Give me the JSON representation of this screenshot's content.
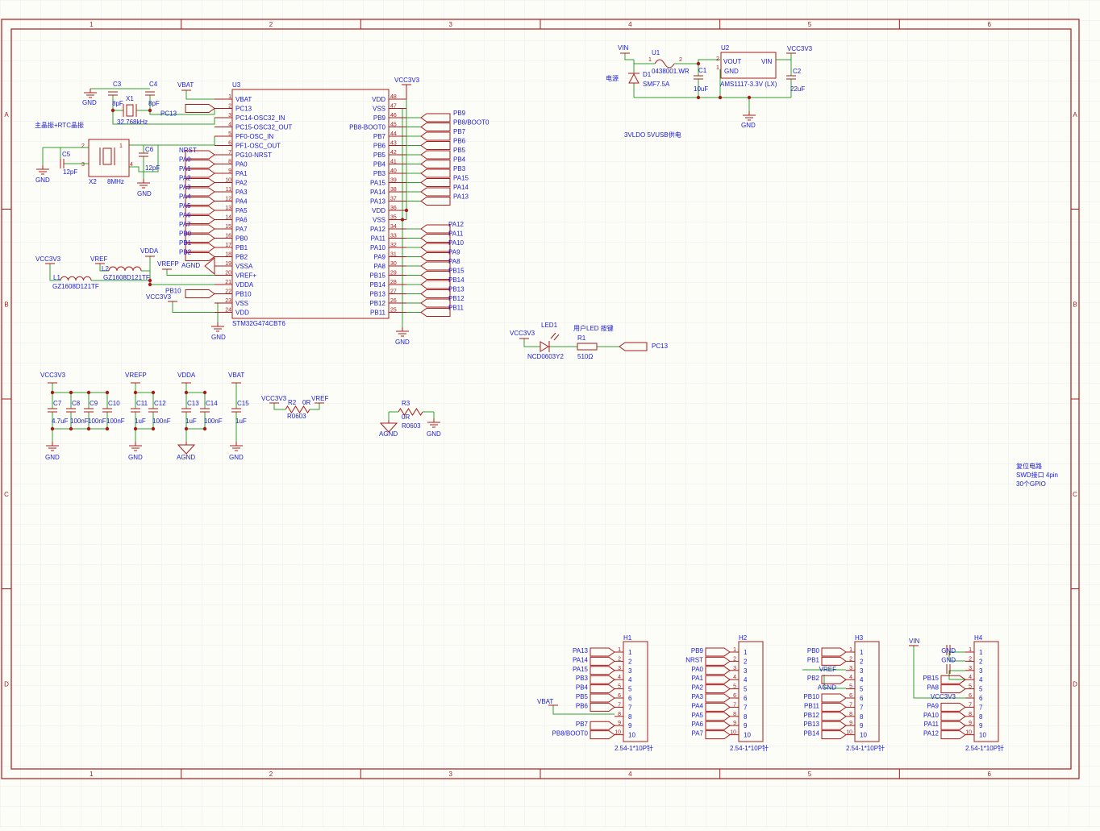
{
  "colors": {
    "frame": "#a61c1c",
    "part": "#a61c1c",
    "wire": "#2e9e2e",
    "text": "#1a1ad6",
    "grid": "#ececec",
    "paper": "#fdfdf8"
  },
  "frame": {
    "cols": [
      "1",
      "2",
      "3",
      "4",
      "5",
      "6"
    ],
    "rows": [
      "A",
      "B",
      "C",
      "D"
    ]
  },
  "mcu": {
    "ref": "U3",
    "part": "STM32G474CBT6",
    "left_pins": [
      {
        "num": "1",
        "name": "VBAT"
      },
      {
        "num": "2",
        "name": "PC13"
      },
      {
        "num": "3",
        "name": "PC14-OSC32_IN"
      },
      {
        "num": "4",
        "name": "PC15-OSC32_OUT"
      },
      {
        "num": "5",
        "name": "PF0-OSC_IN"
      },
      {
        "num": "6",
        "name": "PF1-OSC_OUT"
      },
      {
        "num": "7",
        "name": "PG10-NRST"
      },
      {
        "num": "8",
        "name": "PA0"
      },
      {
        "num": "9",
        "name": "PA1"
      },
      {
        "num": "10",
        "name": "PA2"
      },
      {
        "num": "11",
        "name": "PA3"
      },
      {
        "num": "12",
        "name": "PA4"
      },
      {
        "num": "13",
        "name": "PA5"
      },
      {
        "num": "14",
        "name": "PA6"
      },
      {
        "num": "15",
        "name": "PA7"
      },
      {
        "num": "16",
        "name": "PB0"
      },
      {
        "num": "17",
        "name": "PB1"
      },
      {
        "num": "18",
        "name": "PB2"
      },
      {
        "num": "19",
        "name": "VSSA"
      },
      {
        "num": "20",
        "name": "VREF+"
      },
      {
        "num": "21",
        "name": "VDDA"
      },
      {
        "num": "22",
        "name": "PB10"
      },
      {
        "num": "23",
        "name": "VSS"
      },
      {
        "num": "24",
        "name": "VDD"
      }
    ],
    "right_pins": [
      {
        "num": "48",
        "name": "VDD"
      },
      {
        "num": "47",
        "name": "VSS"
      },
      {
        "num": "46",
        "name": "PB9"
      },
      {
        "num": "45",
        "name": "PB8-BOOT0"
      },
      {
        "num": "44",
        "name": "PB7"
      },
      {
        "num": "43",
        "name": "PB6"
      },
      {
        "num": "42",
        "name": "PB5"
      },
      {
        "num": "41",
        "name": "PB4"
      },
      {
        "num": "40",
        "name": "PB3"
      },
      {
        "num": "39",
        "name": "PA15"
      },
      {
        "num": "38",
        "name": "PA14"
      },
      {
        "num": "37",
        "name": "PA13"
      },
      {
        "num": "36",
        "name": "VDD"
      },
      {
        "num": "35",
        "name": "VSS"
      },
      {
        "num": "34",
        "name": "PA12"
      },
      {
        "num": "33",
        "name": "PA11"
      },
      {
        "num": "32",
        "name": "PA10"
      },
      {
        "num": "31",
        "name": "PA9"
      },
      {
        "num": "30",
        "name": "PA8"
      },
      {
        "num": "29",
        "name": "PB15"
      },
      {
        "num": "28",
        "name": "PB14"
      },
      {
        "num": "27",
        "name": "PB13"
      },
      {
        "num": "26",
        "name": "PB12"
      },
      {
        "num": "25",
        "name": "PB11"
      }
    ],
    "left_ports": [
      "NRST",
      "PA0",
      "PA1",
      "PA2",
      "PA3",
      "PA4",
      "PA5",
      "PA6",
      "PA7",
      "PB0",
      "PB1",
      "PB2"
    ],
    "pc13_port": "PC13",
    "pb10_port": "PB10",
    "top_ports": [
      "PB9",
      "PB8/BOOT0",
      "PB7",
      "PB6",
      "PB5",
      "PB4",
      "PB3",
      "PA15",
      "PA14",
      "PA13"
    ],
    "bottom_ports": [
      "PA12",
      "PA11",
      "PA10",
      "PA9",
      "PA8",
      "PB15",
      "PB14",
      "PB13",
      "PB12",
      "PB11"
    ],
    "vcc_label": "VCC3V3",
    "vbat_label": "VBAT",
    "gnd_label": "GND",
    "vdda_label": "VDDA",
    "vrefp_label": "VREFP",
    "agnd_label": "AGND",
    "vcc_bottom_label": "VCC3V3"
  },
  "clock": {
    "title": "主晶振+RTC晶振",
    "c3": "C3",
    "c3_val": "8pF",
    "c4": "C4",
    "c4_val": "8pF",
    "x1": "X1",
    "x1_val": "32.768kHz",
    "c5": "C5",
    "c5_val": "12pF",
    "c6": "C6",
    "c6_val": "12pF",
    "x2": "X2",
    "x2_val": "8MHz",
    "gnd": "GND",
    "pin1": "1",
    "pin2": "2",
    "pin3": "3",
    "pin4": "4"
  },
  "analog": {
    "vcc": "VCC3V3",
    "vref": "VREF",
    "l1": "L1",
    "l1_val": "GZ1608D121TF",
    "l2": "L2",
    "l2_val": "GZ1608D121TF",
    "vdda": "VDDA",
    "vrefp": "VREFP",
    "agnd": "AGND"
  },
  "decoupling": [
    {
      "net": "VCC3V3",
      "gnd": "GND",
      "caps": [
        {
          "ref": "C7",
          "val": "4.7uF"
        },
        {
          "ref": "C8",
          "val": "100nF"
        },
        {
          "ref": "C9",
          "val": "100nF"
        },
        {
          "ref": "C10",
          "val": "100nF"
        }
      ]
    },
    {
      "net": "VREFP",
      "gnd": "GND",
      "caps": [
        {
          "ref": "C11",
          "val": "1uF"
        },
        {
          "ref": "C12",
          "val": "100nF"
        }
      ]
    },
    {
      "net": "VDDA",
      "gnd": "AGND",
      "caps": [
        {
          "ref": "C13",
          "val": "1uF"
        },
        {
          "ref": "C14",
          "val": "100nF"
        }
      ]
    },
    {
      "net": "VBAT",
      "gnd": "GND",
      "caps": [
        {
          "ref": "C15",
          "val": "1uF"
        }
      ]
    }
  ],
  "r2": {
    "left": "VCC3V3",
    "ref": "R2",
    "val": "0R",
    "pkg": "R0603",
    "right": "VREF"
  },
  "r3": {
    "ref": "R3",
    "val": "0R",
    "pkg": "R0603",
    "left": "AGND",
    "right": "GND"
  },
  "power": {
    "vin": "VIN",
    "u1": "U1",
    "u1_val": "0438001.WR",
    "d1": "D1",
    "d1_val": "SMF7.5A",
    "d1_label": "电源",
    "c1": "C1",
    "c1_val": "10uF",
    "u2": "U2",
    "u2_val": "AMS1117-3.3V (LX)",
    "u2_vout": "VOUT",
    "u2_vin": "VIN",
    "u2_gnd": "GND",
    "c2": "C2",
    "c2_val": "22uF",
    "vcc": "VCC3V3",
    "gnd": "GND",
    "pin1": "1",
    "pin2": "2",
    "pin3": "3",
    "note": "3VLDO 5VUSB供电"
  },
  "led": {
    "vcc": "VCC3V3",
    "ref": "LED1",
    "val": "NCD0603Y2",
    "title": "用户LED 按键",
    "r1": "R1",
    "r1_val": "510Ω",
    "port": "PC13"
  },
  "notes": [
    "复位电路",
    "SWD接口 4pin",
    "30个GPIO"
  ],
  "headers": [
    {
      "ref": "H1",
      "val": "2.54-1*10P针",
      "left": [
        "PA13",
        "PA14",
        "PA15",
        "PB3",
        "PB4",
        "PB5",
        "PB6",
        "",
        "PB7",
        "PB8/BOOT0"
      ],
      "ports": [
        true,
        true,
        true,
        true,
        true,
        true,
        true,
        false,
        true,
        true
      ],
      "extra": "VBAT"
    },
    {
      "ref": "H2",
      "val": "2.54-1*10P针",
      "left": [
        "PB9",
        "NRST",
        "PA0",
        "PA1",
        "PA2",
        "PA3",
        "PA4",
        "PA5",
        "PA6",
        "PA7"
      ],
      "ports": [
        true,
        true,
        true,
        true,
        true,
        true,
        true,
        true,
        true,
        true
      ],
      "extra": ""
    },
    {
      "ref": "H3",
      "val": "2.54-1*10P针",
      "left": [
        "PB0",
        "PB1",
        "VREF",
        "PB2",
        "AGND",
        "PB10",
        "PB11",
        "PB12",
        "PB13",
        "PB14"
      ],
      "ports": [
        true,
        true,
        false,
        true,
        false,
        true,
        true,
        true,
        true,
        true
      ],
      "extra": ""
    },
    {
      "ref": "H4",
      "val": "2.54-1*10P针",
      "left": [
        "GND",
        "GND",
        "",
        "PB15",
        "PA8",
        "VCC3V3",
        "PA9",
        "PA10",
        "PA11",
        "PA12"
      ],
      "ports": [
        false,
        false,
        false,
        true,
        true,
        false,
        true,
        true,
        true,
        true
      ],
      "extra": "VIN"
    }
  ]
}
